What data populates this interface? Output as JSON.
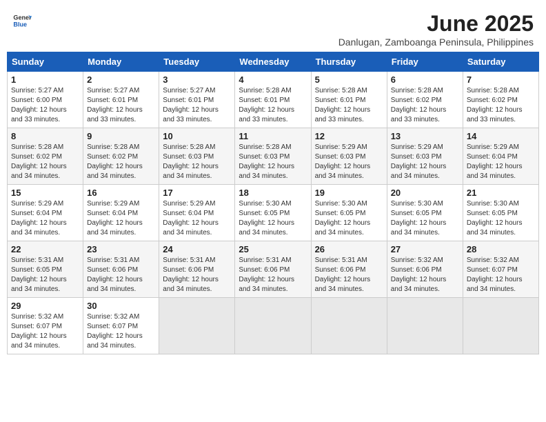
{
  "header": {
    "logo_general": "General",
    "logo_blue": "Blue",
    "month_title": "June 2025",
    "location": "Danlugan, Zamboanga Peninsula, Philippines"
  },
  "days_of_week": [
    "Sunday",
    "Monday",
    "Tuesday",
    "Wednesday",
    "Thursday",
    "Friday",
    "Saturday"
  ],
  "weeks": [
    [
      {
        "day": 1,
        "sunrise": "5:27 AM",
        "sunset": "6:00 PM",
        "daylight": "12 hours and 33 minutes"
      },
      {
        "day": 2,
        "sunrise": "5:27 AM",
        "sunset": "6:01 PM",
        "daylight": "12 hours and 33 minutes"
      },
      {
        "day": 3,
        "sunrise": "5:27 AM",
        "sunset": "6:01 PM",
        "daylight": "12 hours and 33 minutes"
      },
      {
        "day": 4,
        "sunrise": "5:28 AM",
        "sunset": "6:01 PM",
        "daylight": "12 hours and 33 minutes"
      },
      {
        "day": 5,
        "sunrise": "5:28 AM",
        "sunset": "6:01 PM",
        "daylight": "12 hours and 33 minutes"
      },
      {
        "day": 6,
        "sunrise": "5:28 AM",
        "sunset": "6:02 PM",
        "daylight": "12 hours and 33 minutes"
      },
      {
        "day": 7,
        "sunrise": "5:28 AM",
        "sunset": "6:02 PM",
        "daylight": "12 hours and 33 minutes"
      }
    ],
    [
      {
        "day": 8,
        "sunrise": "5:28 AM",
        "sunset": "6:02 PM",
        "daylight": "12 hours and 34 minutes"
      },
      {
        "day": 9,
        "sunrise": "5:28 AM",
        "sunset": "6:02 PM",
        "daylight": "12 hours and 34 minutes"
      },
      {
        "day": 10,
        "sunrise": "5:28 AM",
        "sunset": "6:03 PM",
        "daylight": "12 hours and 34 minutes"
      },
      {
        "day": 11,
        "sunrise": "5:28 AM",
        "sunset": "6:03 PM",
        "daylight": "12 hours and 34 minutes"
      },
      {
        "day": 12,
        "sunrise": "5:29 AM",
        "sunset": "6:03 PM",
        "daylight": "12 hours and 34 minutes"
      },
      {
        "day": 13,
        "sunrise": "5:29 AM",
        "sunset": "6:03 PM",
        "daylight": "12 hours and 34 minutes"
      },
      {
        "day": 14,
        "sunrise": "5:29 AM",
        "sunset": "6:04 PM",
        "daylight": "12 hours and 34 minutes"
      }
    ],
    [
      {
        "day": 15,
        "sunrise": "5:29 AM",
        "sunset": "6:04 PM",
        "daylight": "12 hours and 34 minutes"
      },
      {
        "day": 16,
        "sunrise": "5:29 AM",
        "sunset": "6:04 PM",
        "daylight": "12 hours and 34 minutes"
      },
      {
        "day": 17,
        "sunrise": "5:29 AM",
        "sunset": "6:04 PM",
        "daylight": "12 hours and 34 minutes"
      },
      {
        "day": 18,
        "sunrise": "5:30 AM",
        "sunset": "6:05 PM",
        "daylight": "12 hours and 34 minutes"
      },
      {
        "day": 19,
        "sunrise": "5:30 AM",
        "sunset": "6:05 PM",
        "daylight": "12 hours and 34 minutes"
      },
      {
        "day": 20,
        "sunrise": "5:30 AM",
        "sunset": "6:05 PM",
        "daylight": "12 hours and 34 minutes"
      },
      {
        "day": 21,
        "sunrise": "5:30 AM",
        "sunset": "6:05 PM",
        "daylight": "12 hours and 34 minutes"
      }
    ],
    [
      {
        "day": 22,
        "sunrise": "5:31 AM",
        "sunset": "6:05 PM",
        "daylight": "12 hours and 34 minutes"
      },
      {
        "day": 23,
        "sunrise": "5:31 AM",
        "sunset": "6:06 PM",
        "daylight": "12 hours and 34 minutes"
      },
      {
        "day": 24,
        "sunrise": "5:31 AM",
        "sunset": "6:06 PM",
        "daylight": "12 hours and 34 minutes"
      },
      {
        "day": 25,
        "sunrise": "5:31 AM",
        "sunset": "6:06 PM",
        "daylight": "12 hours and 34 minutes"
      },
      {
        "day": 26,
        "sunrise": "5:31 AM",
        "sunset": "6:06 PM",
        "daylight": "12 hours and 34 minutes"
      },
      {
        "day": 27,
        "sunrise": "5:32 AM",
        "sunset": "6:06 PM",
        "daylight": "12 hours and 34 minutes"
      },
      {
        "day": 28,
        "sunrise": "5:32 AM",
        "sunset": "6:07 PM",
        "daylight": "12 hours and 34 minutes"
      }
    ],
    [
      {
        "day": 29,
        "sunrise": "5:32 AM",
        "sunset": "6:07 PM",
        "daylight": "12 hours and 34 minutes"
      },
      {
        "day": 30,
        "sunrise": "5:32 AM",
        "sunset": "6:07 PM",
        "daylight": "12 hours and 34 minutes"
      },
      null,
      null,
      null,
      null,
      null
    ]
  ]
}
